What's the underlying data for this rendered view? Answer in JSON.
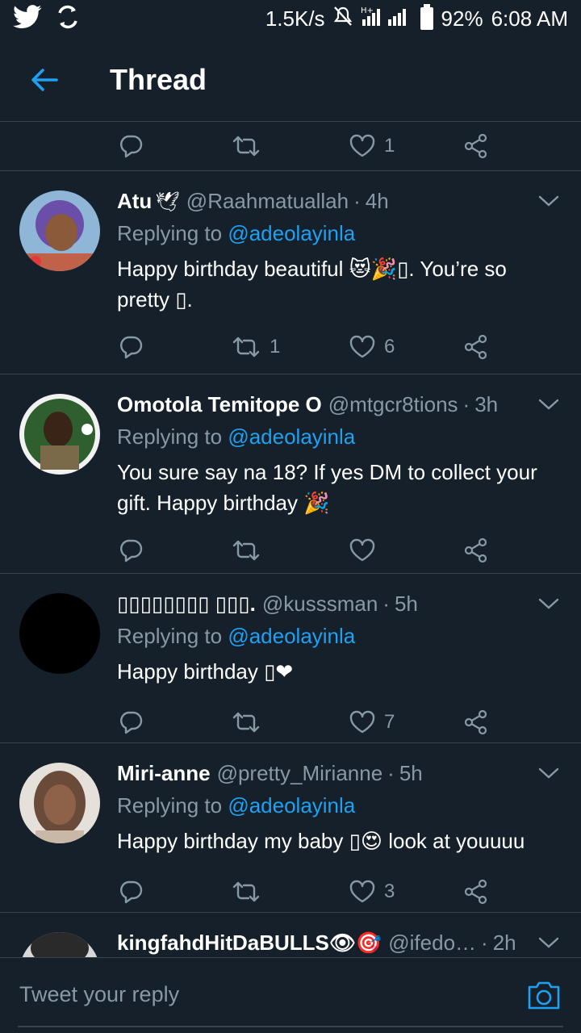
{
  "status_bar": {
    "net_speed": "1.5K/s",
    "network_type": "H+",
    "battery": "92%",
    "time": "6:08 AM"
  },
  "app_bar": {
    "title": "Thread"
  },
  "top_actions": {
    "like_count": "1"
  },
  "tweets": [
    {
      "name": "Atu",
      "handle": "@Raahmatuallah",
      "time": "4h",
      "replying_prefix": "Replying to",
      "mention": "@adeolayinla",
      "text": "Happy birthday beautiful 😻🎉▯. You’re so pretty ▯.",
      "retweets": "1",
      "likes": "6"
    },
    {
      "name": "Omotola Temitope O",
      "handle": "@mtgcr8tions",
      "time": "3h",
      "replying_prefix": "Replying to",
      "mention": "@adeolayinla",
      "text": "You sure say na 18? If yes DM to collect your gift. Happy birthday 🎉",
      "retweets": "",
      "likes": ""
    },
    {
      "name": "▯▯▯▯▯▯▯▯ ▯▯▯.",
      "handle": "@kusssman",
      "time": "5h",
      "replying_prefix": "Replying to",
      "mention": "@adeolayinla",
      "text": "Happy birthday ▯❤",
      "retweets": "",
      "likes": "7"
    },
    {
      "name": "Miri-anne",
      "handle": "@pretty_Mirianne",
      "time": "5h",
      "replying_prefix": "Replying to",
      "mention": "@adeolayinla",
      "text": "Happy birthday my baby ▯😍 look at youuuu",
      "retweets": "",
      "likes": "3"
    },
    {
      "name": "kingfahdHitDaBULLS👁🎯",
      "handle": "@ifedo…",
      "time": "2h"
    }
  ],
  "composer": {
    "placeholder": "Tweet your reply"
  },
  "colors": {
    "background": "#15202b",
    "divider": "#38444d",
    "secondary_text": "#8899a6",
    "accent": "#1da1f2"
  }
}
